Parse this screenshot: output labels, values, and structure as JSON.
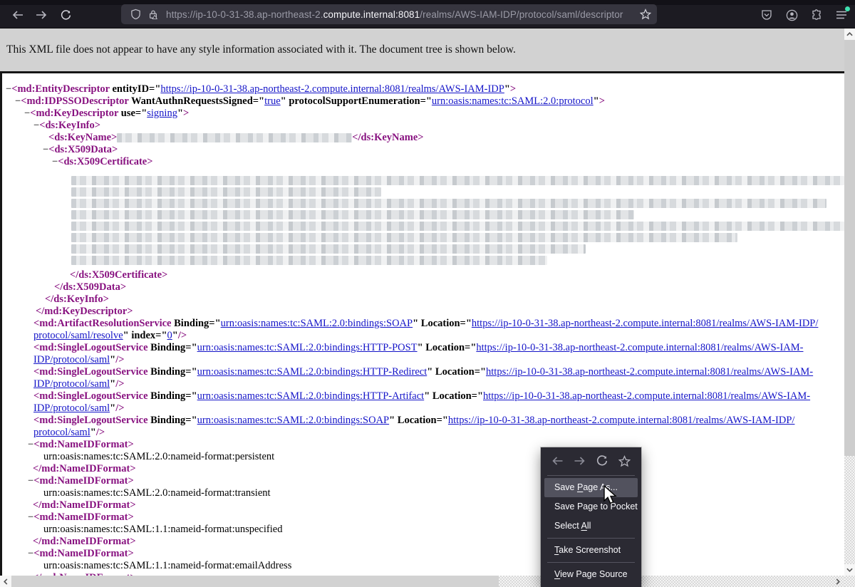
{
  "browser": {
    "url": {
      "prefix": "https://ip-10-0-31-38.ap-northeast-2.",
      "domain": "compute.internal:8081",
      "path": "/realms/AWS-IAM-IDP/protocol/saml/descriptor"
    },
    "icons": [
      "back-icon",
      "forward-icon",
      "reload-icon",
      "shield-icon",
      "lock-warning-icon",
      "bookmark-star-icon",
      "pocket-icon",
      "account-icon",
      "extensions-icon",
      "menu-icon"
    ],
    "colors": {
      "toolbar_bg": "#1c1b22",
      "urlbar_bg": "#36353f",
      "notification_dot": "#3fe1b0"
    }
  },
  "notice": {
    "text": "This XML file does not appear to have any style information associated with it. The document tree is shown below."
  },
  "xml": {
    "colors": {
      "tag": "#881280",
      "attribute_value": "#1414c8",
      "text": "#000000"
    },
    "lines": [
      {
        "i": 5,
        "tk": [
          [
            "m",
            "−"
          ],
          [
            "t",
            "<md:EntityDescriptor"
          ],
          [
            "a",
            " entityID="
          ],
          [
            "q",
            "\""
          ],
          [
            "v",
            "https://ip-10-0-31-38.ap-northeast-2.compute.internal:8081/realms/AWS-IAM-IDP"
          ],
          [
            "q",
            "\""
          ],
          [
            "t",
            ">"
          ]
        ]
      },
      {
        "i": 18,
        "tk": [
          [
            "m",
            "−"
          ],
          [
            "t",
            "<md:IDPSSODescriptor"
          ],
          [
            "a",
            " WantAuthnRequestsSigned="
          ],
          [
            "q",
            "\""
          ],
          [
            "v",
            "true"
          ],
          [
            "q",
            "\""
          ],
          [
            "a",
            " protocolSupportEnumeration="
          ],
          [
            "q",
            "\""
          ],
          [
            "v",
            "urn:oasis:names:tc:SAML:2.0:protocol"
          ],
          [
            "q",
            "\""
          ],
          [
            "t",
            ">"
          ]
        ]
      },
      {
        "i": 31,
        "tk": [
          [
            "m",
            "−"
          ],
          [
            "t",
            "<md:KeyDescriptor"
          ],
          [
            "a",
            " use="
          ],
          [
            "q",
            "\""
          ],
          [
            "v",
            "signing"
          ],
          [
            "q",
            "\""
          ],
          [
            "t",
            ">"
          ]
        ]
      },
      {
        "i": 44,
        "tk": [
          [
            "m",
            "−"
          ],
          [
            "t",
            "<ds:KeyInfo>"
          ]
        ]
      },
      {
        "i": 65,
        "tk": [
          [
            "t",
            "<ds:KeyName>"
          ],
          [
            "r",
            "330"
          ],
          [
            "t",
            "</ds:KeyName>"
          ]
        ]
      },
      {
        "i": 57,
        "tk": [
          [
            "m",
            "−"
          ],
          [
            "t",
            "<ds:X509Data>"
          ]
        ]
      },
      {
        "i": 70,
        "tk": [
          [
            "m",
            "−"
          ],
          [
            "t",
            "<ds:X509Certificate>"
          ]
        ]
      },
      {
        "i": 97,
        "h": 8,
        "tk": []
      },
      {
        "i": 97,
        "R": 1085,
        "tk": []
      },
      {
        "i": 97,
        "R": 435,
        "tk": []
      },
      {
        "i": 97,
        "R": 1060,
        "tk": []
      },
      {
        "i": 97,
        "R": 790,
        "tk": []
      },
      {
        "i": 97,
        "R": 1088,
        "tk": []
      },
      {
        "i": 97,
        "R": 935,
        "tk": []
      },
      {
        "i": 97,
        "R": 722,
        "tk": []
      },
      {
        "i": 97,
        "R": 668,
        "tk": []
      },
      {
        "i": 97,
        "h": 6,
        "tk": []
      },
      {
        "i": 95,
        "tk": [
          [
            "t",
            "</ds:X509Certificate>"
          ]
        ]
      },
      {
        "i": 73,
        "tk": [
          [
            "t",
            "</ds:X509Data>"
          ]
        ]
      },
      {
        "i": 60,
        "tk": [
          [
            "t",
            "</ds:KeyInfo>"
          ]
        ]
      },
      {
        "i": 47,
        "tk": [
          [
            "t",
            "</md:KeyDescriptor>"
          ]
        ]
      },
      {
        "i": 44,
        "tk": [
          [
            "t",
            "<md:ArtifactResolutionService"
          ],
          [
            "a",
            " Binding="
          ],
          [
            "q",
            "\""
          ],
          [
            "v",
            "urn:oasis:names:tc:SAML:2.0:bindings:SOAP"
          ],
          [
            "q",
            "\""
          ],
          [
            "a",
            " Location="
          ],
          [
            "q",
            "\""
          ],
          [
            "v",
            "https://ip-10-0-31-38.ap-northeast-2.compute.internal:8081/realms/AWS-IAM-IDP/"
          ]
        ]
      },
      {
        "i": 44,
        "tk": [
          [
            "v",
            "protocol/saml/resolve"
          ],
          [
            "q",
            "\""
          ],
          [
            "a",
            " index="
          ],
          [
            "q",
            "\""
          ],
          [
            "v",
            "0"
          ],
          [
            "q",
            "\""
          ],
          [
            "t",
            "/>"
          ]
        ]
      },
      {
        "i": 44,
        "tk": [
          [
            "t",
            "<md:SingleLogoutService"
          ],
          [
            "a",
            " Binding="
          ],
          [
            "q",
            "\""
          ],
          [
            "v",
            "urn:oasis:names:tc:SAML:2.0:bindings:HTTP-POST"
          ],
          [
            "q",
            "\""
          ],
          [
            "a",
            " Location="
          ],
          [
            "q",
            "\""
          ],
          [
            "v",
            "https://ip-10-0-31-38.ap-northeast-2.compute.internal:8081/realms/AWS-IAM-"
          ]
        ]
      },
      {
        "i": 44,
        "tk": [
          [
            "v",
            "IDP/protocol/saml"
          ],
          [
            "q",
            "\""
          ],
          [
            "t",
            "/>"
          ]
        ]
      },
      {
        "i": 44,
        "tk": [
          [
            "t",
            "<md:SingleLogoutService"
          ],
          [
            "a",
            " Binding="
          ],
          [
            "q",
            "\""
          ],
          [
            "v",
            "urn:oasis:names:tc:SAML:2.0:bindings:HTTP-Redirect"
          ],
          [
            "q",
            "\""
          ],
          [
            "a",
            " Location="
          ],
          [
            "q",
            "\""
          ],
          [
            "v",
            "https://ip-10-0-31-38.ap-northeast-2.compute.internal:8081/realms/AWS-IAM-"
          ]
        ]
      },
      {
        "i": 44,
        "tk": [
          [
            "v",
            "IDP/protocol/saml"
          ],
          [
            "q",
            "\""
          ],
          [
            "t",
            "/>"
          ]
        ]
      },
      {
        "i": 44,
        "tk": [
          [
            "t",
            "<md:SingleLogoutService"
          ],
          [
            "a",
            " Binding="
          ],
          [
            "q",
            "\""
          ],
          [
            "v",
            "urn:oasis:names:tc:SAML:2.0:bindings:HTTP-Artifact"
          ],
          [
            "q",
            "\""
          ],
          [
            "a",
            " Location="
          ],
          [
            "q",
            "\""
          ],
          [
            "v",
            "https://ip-10-0-31-38.ap-northeast-2.compute.internal:8081/realms/AWS-IAM-"
          ]
        ]
      },
      {
        "i": 44,
        "tk": [
          [
            "v",
            "IDP/protocol/saml"
          ],
          [
            "q",
            "\""
          ],
          [
            "t",
            "/>"
          ]
        ]
      },
      {
        "i": 44,
        "tk": [
          [
            "t",
            "<md:SingleLogoutService"
          ],
          [
            "a",
            " Binding="
          ],
          [
            "q",
            "\""
          ],
          [
            "v",
            "urn:oasis:names:tc:SAML:2.0:bindings:SOAP"
          ],
          [
            "q",
            "\""
          ],
          [
            "a",
            " Location="
          ],
          [
            "q",
            "\""
          ],
          [
            "v",
            "https://ip-10-0-31-38.ap-northeast-2.compute.internal:8081/realms/AWS-IAM-IDP/"
          ]
        ]
      },
      {
        "i": 44,
        "tk": [
          [
            "v",
            "protocol/saml"
          ],
          [
            "q",
            "\""
          ],
          [
            "t",
            "/>"
          ]
        ]
      },
      {
        "i": 36,
        "tk": [
          [
            "m",
            "−"
          ],
          [
            "t",
            "<md:NameIDFormat>"
          ]
        ]
      },
      {
        "i": 58,
        "tk": [
          [
            "x",
            "urn:oasis:names:tc:SAML:2.0:nameid-format:persistent"
          ]
        ]
      },
      {
        "i": 43,
        "tk": [
          [
            "t",
            "</md:NameIDFormat>"
          ]
        ]
      },
      {
        "i": 36,
        "tk": [
          [
            "m",
            "−"
          ],
          [
            "t",
            "<md:NameIDFormat>"
          ]
        ]
      },
      {
        "i": 58,
        "tk": [
          [
            "x",
            "urn:oasis:names:tc:SAML:2.0:nameid-format:transient"
          ]
        ]
      },
      {
        "i": 43,
        "tk": [
          [
            "t",
            "</md:NameIDFormat>"
          ]
        ]
      },
      {
        "i": 36,
        "tk": [
          [
            "m",
            "−"
          ],
          [
            "t",
            "<md:NameIDFormat>"
          ]
        ]
      },
      {
        "i": 58,
        "tk": [
          [
            "x",
            "urn:oasis:names:tc:SAML:1.1:nameid-format:unspecified"
          ]
        ]
      },
      {
        "i": 43,
        "tk": [
          [
            "t",
            "</md:NameIDFormat>"
          ]
        ]
      },
      {
        "i": 36,
        "tk": [
          [
            "m",
            "−"
          ],
          [
            "t",
            "<md:NameIDFormat>"
          ]
        ]
      },
      {
        "i": 58,
        "tk": [
          [
            "x",
            "urn:oasis:names:tc:SAML:1.1:nameid-format:emailAddress"
          ]
        ]
      },
      {
        "i": 43,
        "tk": [
          [
            "t",
            "</md:NameIDFormat>"
          ]
        ]
      }
    ]
  },
  "context_menu": {
    "nav_icons": [
      "back-icon",
      "forward-icon",
      "reload-icon",
      "bookmark-star-icon"
    ],
    "items": [
      {
        "name": "save-page-as",
        "pre": "Save ",
        "key": "P",
        "post": "age As...",
        "highlighted": true
      },
      {
        "name": "save-page-to-pocket",
        "pre": "Save Page to Pocket",
        "key": "",
        "post": "",
        "highlighted": false
      },
      {
        "name": "select-all",
        "pre": "Select ",
        "key": "A",
        "post": "ll",
        "highlighted": false
      },
      {
        "name": "take-screenshot",
        "pre": "",
        "key": "T",
        "post": "ake Screenshot",
        "highlighted": false,
        "sep_before": true
      },
      {
        "name": "view-page-source",
        "pre": "",
        "key": "V",
        "post": "iew Page Source",
        "highlighted": false,
        "sep_before": true
      }
    ],
    "colors": {
      "bg": "#2b2a33",
      "highlight": "#52525e",
      "text": "#fbfbfe"
    }
  }
}
